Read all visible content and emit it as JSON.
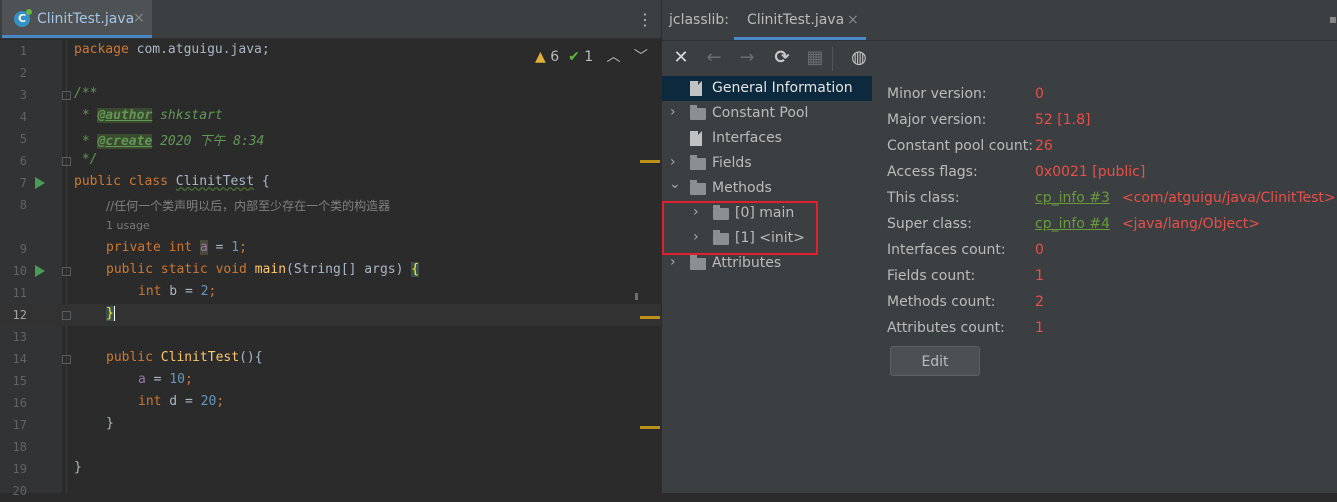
{
  "editor": {
    "tab": {
      "label": "ClinitTest.java",
      "close": "×",
      "icon": "java-class-icon"
    },
    "menu": "⋮",
    "indicators": {
      "warnings": "6",
      "checks": "1",
      "up": "︿",
      "down": "﹀"
    },
    "line_numbers": [
      "1",
      "2",
      "3",
      "4",
      "5",
      "6",
      "7",
      "8",
      "9",
      "10",
      "11",
      "12",
      "13",
      "14",
      "15",
      "16",
      "17",
      "18",
      "19",
      "20"
    ],
    "code": {
      "l1_kw": "package",
      "l1_rest": " com.atguigu.java;",
      "l3": "/**",
      "l4_star": " * ",
      "l4_tag": "@author",
      "l4_rest": " shkstart",
      "l5_star": " * ",
      "l5_tag": "@create",
      "l5_rest": " 2020 下午 8:34",
      "l6": " */",
      "l7_kw1": "public",
      "l7_kw2": " class ",
      "l7_cls": "ClinitTest",
      "l7_rest": " {",
      "l8_comment": "//任何一个类声明以后，内部至少存在一个类的构造器",
      "usage_hint": "1 usage",
      "l9_kw1": "private",
      "l9_kw2": " int ",
      "l9_fld": "a",
      "l9_rest": " = ",
      "l9_num": "1",
      "l9_end": ";",
      "l10_kw": "public static void ",
      "l10_mth": "main",
      "l10_rest": "(String[] args) ",
      "l10_brace": "{",
      "l11_kw": "int",
      "l11_rest": " b = ",
      "l11_num": "2",
      "l11_end": ";",
      "l12_brace": "}",
      "l14_kw": "public ",
      "l14_mth": "ClinitTest",
      "l14_rest": "(){",
      "l15_fld": "a",
      "l15_rest": " = ",
      "l15_num": "10",
      "l15_end": ";",
      "l16_kw": "int",
      "l16_rest": " d = ",
      "l16_num": "20",
      "l16_end": ";",
      "l17": "}",
      "l19": "}"
    }
  },
  "jclasslib": {
    "label": "jclasslib:",
    "tab": {
      "label": "ClinitTest.java",
      "close": "×"
    },
    "toolbar": {
      "close": "✕",
      "back": "←",
      "forward": "→",
      "refresh": "⟳",
      "save": "▦",
      "web": "◍"
    },
    "tree": [
      {
        "label": "General Information",
        "icon": "file-icon",
        "selected": true
      },
      {
        "label": "Constant Pool",
        "icon": "folder-icon",
        "arrow": "›"
      },
      {
        "label": "Interfaces",
        "icon": "file-icon"
      },
      {
        "label": "Fields",
        "icon": "folder-icon",
        "arrow": "›"
      },
      {
        "label": "Methods",
        "icon": "folder-icon",
        "arrow": "⌄"
      },
      {
        "label": "[0] main",
        "icon": "folder-icon",
        "arrow": "›"
      },
      {
        "label": "[1] <init>",
        "icon": "folder-icon",
        "arrow": "›"
      },
      {
        "label": "Attributes",
        "icon": "folder-icon",
        "arrow": "›"
      }
    ],
    "general_info": [
      {
        "key": "Minor version:",
        "value": "0"
      },
      {
        "key": "Major version:",
        "value": "52 [1.8]"
      },
      {
        "key": "Constant pool count:",
        "value": "26"
      },
      {
        "key": "Access flags:",
        "value": "0x0021 [public]"
      },
      {
        "key": "This class:",
        "link": "cp_info #3",
        "desc": "<com/atguigu/java/ClinitTest>"
      },
      {
        "key": "Super class:",
        "link": "cp_info #4",
        "desc": "<java/lang/Object>"
      },
      {
        "key": "Interfaces count:",
        "value": "0"
      },
      {
        "key": "Fields count:",
        "value": "1"
      },
      {
        "key": "Methods count:",
        "value": "2"
      },
      {
        "key": "Attributes count:",
        "value": "1"
      }
    ],
    "edit_button": "Edit"
  },
  "colors": {
    "accent": "#4a88c7",
    "highlight_box": "#e0212b",
    "value_red": "#e84f4a",
    "link_green": "#6a9a3c"
  }
}
